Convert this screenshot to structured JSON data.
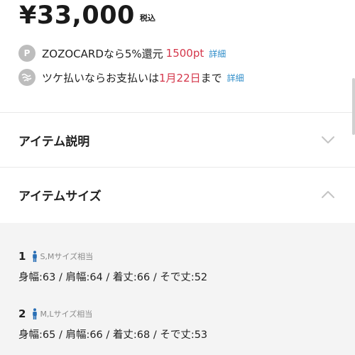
{
  "price": {
    "amount": "¥33,000",
    "tax_label": "税込"
  },
  "zozocard": {
    "badge": "P",
    "text": "ZOZOCARDなら5%還元",
    "points": "1500pt",
    "link": "詳細"
  },
  "tsuke": {
    "text_before": "ツケ払いならお支払いは",
    "date": "1月22日",
    "text_after": "まで",
    "link": "詳細"
  },
  "accordions": {
    "description": {
      "title": "アイテム説明",
      "state": "collapsed"
    },
    "size": {
      "title": "アイテムサイズ",
      "state": "expanded"
    }
  },
  "sizes": [
    {
      "number": "1",
      "note": "S,Mサイズ相当",
      "measurements": "身幅:63 / 肩幅:64 / 着丈:66 / そで丈:52"
    },
    {
      "number": "2",
      "note": "M,Lサイズ相当",
      "measurements": "身幅:65 / 肩幅:66 / 着丈:68 / そで丈:53"
    }
  ],
  "colors": {
    "accent_red": "#d4364a",
    "link_blue": "#2f8dc9",
    "person_icon": "#2a6fb5"
  },
  "icons": {
    "zozocard": "point-p-icon",
    "tsuke": "tsuke-swirl-icon",
    "collapsed": "chevron-down-icon",
    "expanded": "chevron-up-icon",
    "size_person": "person-icon"
  }
}
